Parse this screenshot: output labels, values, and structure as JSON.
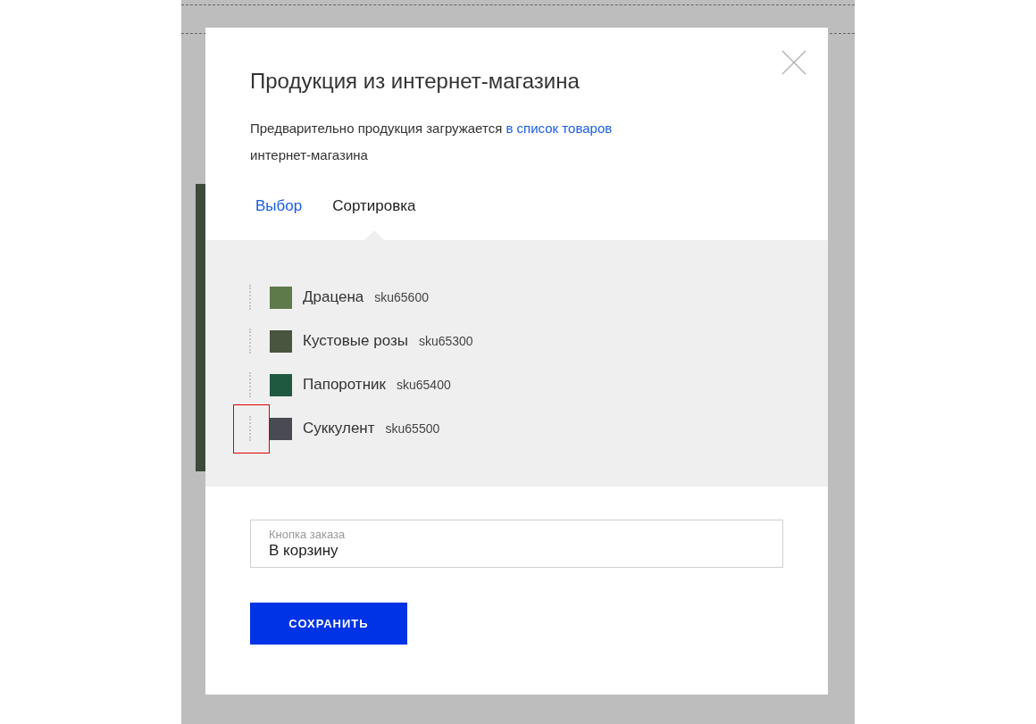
{
  "dialog": {
    "title": "Продукция из интернет-магазина",
    "description": {
      "text": "Предварительно продукция загружается",
      "link": "в список товаров",
      "text_after": "интернет-магазина"
    }
  },
  "tabs": [
    {
      "label": "Выбор",
      "selected": false
    },
    {
      "label": "Сортировка",
      "selected": true
    }
  ],
  "items": [
    {
      "name": "Драцена",
      "sku": "sku65600",
      "highlighted": false,
      "color": "#5f7a4a"
    },
    {
      "name": "Кустовые розы",
      "sku": "sku65300",
      "highlighted": false,
      "color": "#4a5540"
    },
    {
      "name": "Папоротник",
      "sku": "sku65400",
      "highlighted": false,
      "color": "#1f5a40"
    },
    {
      "name": "Суккулент",
      "sku": "sku65500",
      "highlighted": true,
      "color": "#4a4a52"
    }
  ],
  "order_button_field": {
    "label": "Кнопка заказа",
    "value": "В корзину"
  },
  "save_button": "СОХРАНИТЬ"
}
